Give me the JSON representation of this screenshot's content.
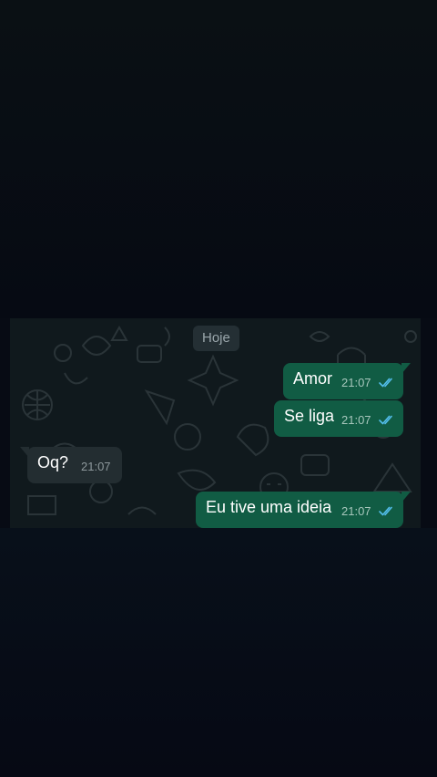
{
  "chat": {
    "date_label": "Hoje",
    "messages": [
      {
        "direction": "outgoing",
        "text": "Amor",
        "time": "21:07",
        "status": "read"
      },
      {
        "direction": "outgoing",
        "text": "Se liga",
        "time": "21:07",
        "status": "read"
      },
      {
        "direction": "incoming",
        "text": "Oq?",
        "time": "21:07"
      },
      {
        "direction": "outgoing",
        "text": "Eu tive uma ideia",
        "time": "21:07",
        "status": "read"
      }
    ]
  },
  "colors": {
    "outgoing_bubble": "#115c44",
    "incoming_bubble": "#232d31",
    "chat_background": "#10191d",
    "read_ticks": "#53bdeb"
  },
  "icons": {
    "read_receipt": "double-check-icon",
    "wallpaper": "doodle-wallpaper"
  }
}
